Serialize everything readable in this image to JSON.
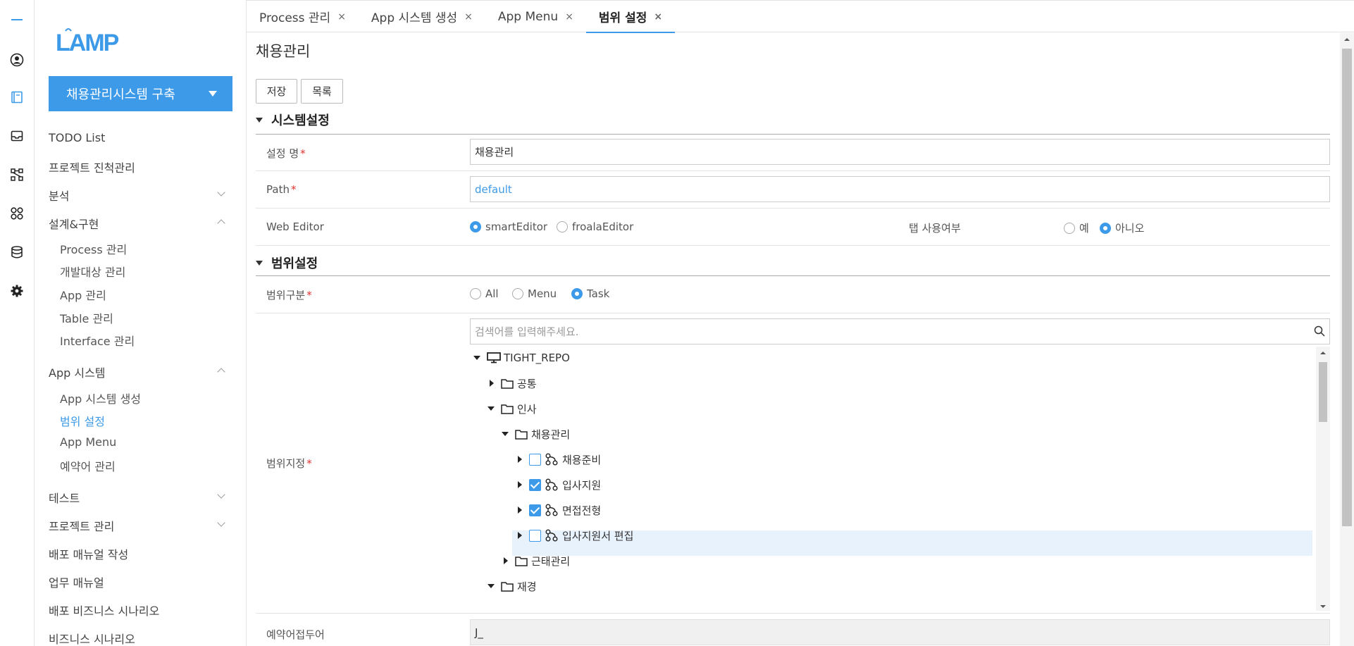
{
  "rail": {
    "icons": [
      "menu-icon",
      "user-icon",
      "book-icon",
      "inbox-icon",
      "flow-icon",
      "apps-icon",
      "database-icon",
      "gear-icon"
    ]
  },
  "colors": {
    "accent": "#3d9ae8",
    "required": "#e0322f"
  },
  "sidebar": {
    "logo_text": "LAMP",
    "project": "채용관리시스템 구축",
    "items": [
      {
        "label": "TODO List"
      },
      {
        "label": "프로젝트 진척관리"
      },
      {
        "label": "분석"
      },
      {
        "label": "설계&구현"
      },
      {
        "label": "App 시스템"
      },
      {
        "label": "테스트"
      },
      {
        "label": "프로젝트 관리"
      },
      {
        "label": "배포 매뉴얼 작성"
      },
      {
        "label": "업무 매뉴얼"
      },
      {
        "label": "배포 비즈니스 시나리오"
      },
      {
        "label": "비즈니스 시나리오"
      }
    ],
    "design_sub": [
      "Process 관리",
      "개발대상 관리",
      "App 관리",
      "Table 관리",
      "Interface 관리"
    ],
    "app_sub": [
      "App 시스템 생성",
      "범위 설정",
      "App Menu",
      "예약어 관리"
    ]
  },
  "tabs": [
    {
      "label": "Process 관리",
      "close": "×"
    },
    {
      "label": "App 시스템 생성",
      "close": "×"
    },
    {
      "label": "App Menu",
      "close": "×"
    },
    {
      "label": "범위 설정",
      "close": "×"
    }
  ],
  "main": {
    "title": "채용관리",
    "save_label": "저장",
    "list_label": "목록",
    "required_mark": "*",
    "section1": "시스템설정",
    "section2": "범위설정",
    "fields": {
      "name_label": "설정 명",
      "name_value": "채용관리",
      "path_label": "Path",
      "path_value": "default",
      "editor_label": "Web Editor",
      "editor_options": [
        "smartEditor",
        "froalaEditor"
      ],
      "editor_selected": "smartEditor",
      "tab_label": "탭 사용여부",
      "tab_options": [
        "예",
        "아니오"
      ],
      "tab_selected": "아니오",
      "scope_type_label": "범위구분",
      "scope_options": [
        "All",
        "Menu",
        "Task"
      ],
      "scope_selected": "Task",
      "scope_assign_label": "범위지정",
      "reserved_label": "예약어접두어",
      "reserved_value": "J_"
    },
    "search_placeholder": "검색어를 입력해주세요.",
    "tree": {
      "root": "TIGHT_REPO",
      "n1": "공통",
      "n2": "인사",
      "n3": "채용관리",
      "t1": "채용준비",
      "t2": "입사지원",
      "t3": "면접전형",
      "t4": "입사지원서 편집",
      "n4": "근태관리",
      "n5": "재경"
    }
  }
}
